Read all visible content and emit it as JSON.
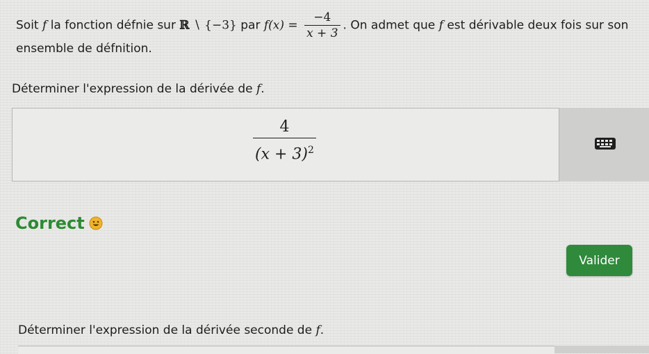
{
  "problem": {
    "intro": "Soit",
    "f": "f",
    "defined_text": "la fonction défnie sur",
    "domain_R": "ℝ",
    "domain_rest": " ∖ {−3}",
    "par": "par",
    "fx": "f(x)",
    "equals": "=",
    "numerator": "−4",
    "denominator": "x + 3",
    "after": ". On admet que",
    "after2": "est dérivable deux fois sur son",
    "line2": "ensemble de défnition."
  },
  "question1": {
    "text": "Déterminer l'expression de la dérivée de",
    "var": "f",
    "end": "."
  },
  "answer1": {
    "numerator": "4",
    "denominator_base": "(x + 3)",
    "denominator_exp": "2"
  },
  "feedback": {
    "label": "Correct",
    "icon": "smile-icon",
    "color": "#2d8a33"
  },
  "validate_button": {
    "label": "Valider",
    "color": "#2f8a3c"
  },
  "question2": {
    "text": "Déterminer l'expression de la dérivée seconde de",
    "var": "f",
    "end": "."
  }
}
